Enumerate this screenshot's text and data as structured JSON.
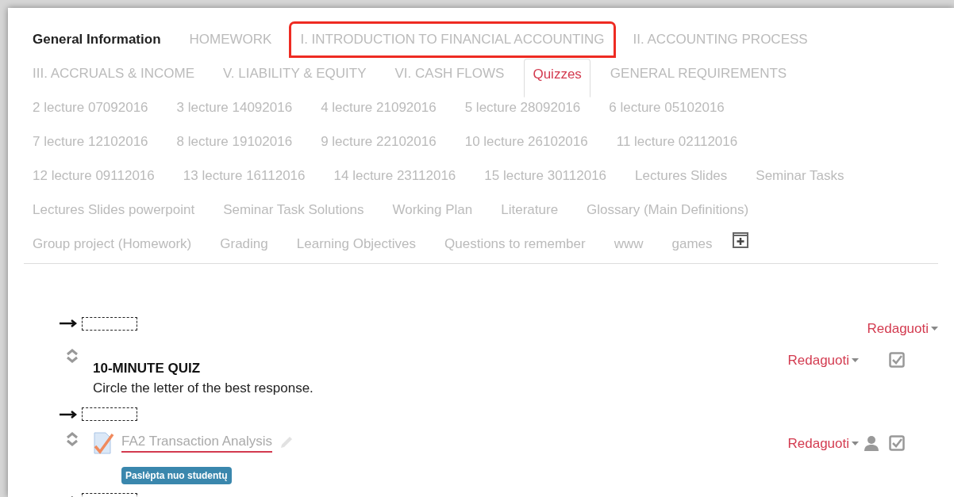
{
  "tab_rows": [
    [
      {
        "label": "General Information",
        "selected": false,
        "bold": true,
        "highlighted": false
      },
      {
        "label": "HOMEWORK",
        "selected": false,
        "bold": false,
        "highlighted": false
      },
      {
        "label": "I. INTRODUCTION TO FINANCIAL ACCOUNTING",
        "selected": false,
        "bold": false,
        "highlighted": true
      },
      {
        "label": "II. ACCOUNTING PROCESS",
        "selected": false,
        "bold": false,
        "highlighted": false
      }
    ],
    [
      {
        "label": "III. ACCRUALS & INCOME",
        "selected": false,
        "bold": false,
        "highlighted": false
      },
      {
        "label": "V. LIABILITY & EQUITY",
        "selected": false,
        "bold": false,
        "highlighted": false
      },
      {
        "label": "VI. CASH FLOWS",
        "selected": false,
        "bold": false,
        "highlighted": false
      },
      {
        "label": "Quizzes",
        "selected": true,
        "bold": false,
        "highlighted": false
      },
      {
        "label": "GENERAL REQUIREMENTS",
        "selected": false,
        "bold": false,
        "highlighted": false
      }
    ],
    [
      {
        "label": "2 lecture 07092016",
        "selected": false,
        "bold": false,
        "highlighted": false
      },
      {
        "label": "3 lecture 14092016",
        "selected": false,
        "bold": false,
        "highlighted": false
      },
      {
        "label": "4 lecture 21092016",
        "selected": false,
        "bold": false,
        "highlighted": false
      },
      {
        "label": "5 lecture 28092016",
        "selected": false,
        "bold": false,
        "highlighted": false
      },
      {
        "label": "6 lecture 05102016",
        "selected": false,
        "bold": false,
        "highlighted": false
      }
    ],
    [
      {
        "label": "7 lecture 12102016",
        "selected": false,
        "bold": false,
        "highlighted": false
      },
      {
        "label": "8 lecture 19102016",
        "selected": false,
        "bold": false,
        "highlighted": false
      },
      {
        "label": "9 lecture 22102016",
        "selected": false,
        "bold": false,
        "highlighted": false
      },
      {
        "label": "10 lecture 26102016",
        "selected": false,
        "bold": false,
        "highlighted": false
      },
      {
        "label": "11 lecture 02112016",
        "selected": false,
        "bold": false,
        "highlighted": false
      }
    ],
    [
      {
        "label": "12 lecture 09112016",
        "selected": false,
        "bold": false,
        "highlighted": false
      },
      {
        "label": "13 lecture 16112016",
        "selected": false,
        "bold": false,
        "highlighted": false
      },
      {
        "label": "14 lecture 23112016",
        "selected": false,
        "bold": false,
        "highlighted": false
      },
      {
        "label": "15 lecture 30112016",
        "selected": false,
        "bold": false,
        "highlighted": false
      },
      {
        "label": "Lectures Slides",
        "selected": false,
        "bold": false,
        "highlighted": false
      },
      {
        "label": "Seminar Tasks",
        "selected": false,
        "bold": false,
        "highlighted": false
      }
    ],
    [
      {
        "label": "Lectures Slides powerpoint",
        "selected": false,
        "bold": false,
        "highlighted": false
      },
      {
        "label": "Seminar Task Solutions",
        "selected": false,
        "bold": false,
        "highlighted": false
      },
      {
        "label": "Working Plan",
        "selected": false,
        "bold": false,
        "highlighted": false
      },
      {
        "label": "Literature",
        "selected": false,
        "bold": false,
        "highlighted": false
      },
      {
        "label": "Glossary (Main Definitions)",
        "selected": false,
        "bold": false,
        "highlighted": false
      }
    ],
    [
      {
        "label": "Group project (Homework)",
        "selected": false,
        "bold": false,
        "highlighted": false
      },
      {
        "label": "Grading",
        "selected": false,
        "bold": false,
        "highlighted": false
      },
      {
        "label": "Learning Objectives",
        "selected": false,
        "bold": false,
        "highlighted": false
      },
      {
        "label": "Questions to remember",
        "selected": false,
        "bold": false,
        "highlighted": false
      },
      {
        "label": "www",
        "selected": false,
        "bold": false,
        "highlighted": false
      },
      {
        "label": "games",
        "selected": false,
        "bold": false,
        "highlighted": false
      }
    ]
  ],
  "section": {
    "edit_menu": "Redaguoti"
  },
  "activities": [
    {
      "kind": "label",
      "title": "10-MINUTE QUIZ",
      "description": "Circle the letter of the best response.",
      "edit_menu": "Redaguoti"
    },
    {
      "kind": "quiz",
      "title": "FA2 Transaction Analysis",
      "hidden_badge": "Paslėpta nuo studentų",
      "edit_menu": "Redaguoti"
    }
  ]
}
